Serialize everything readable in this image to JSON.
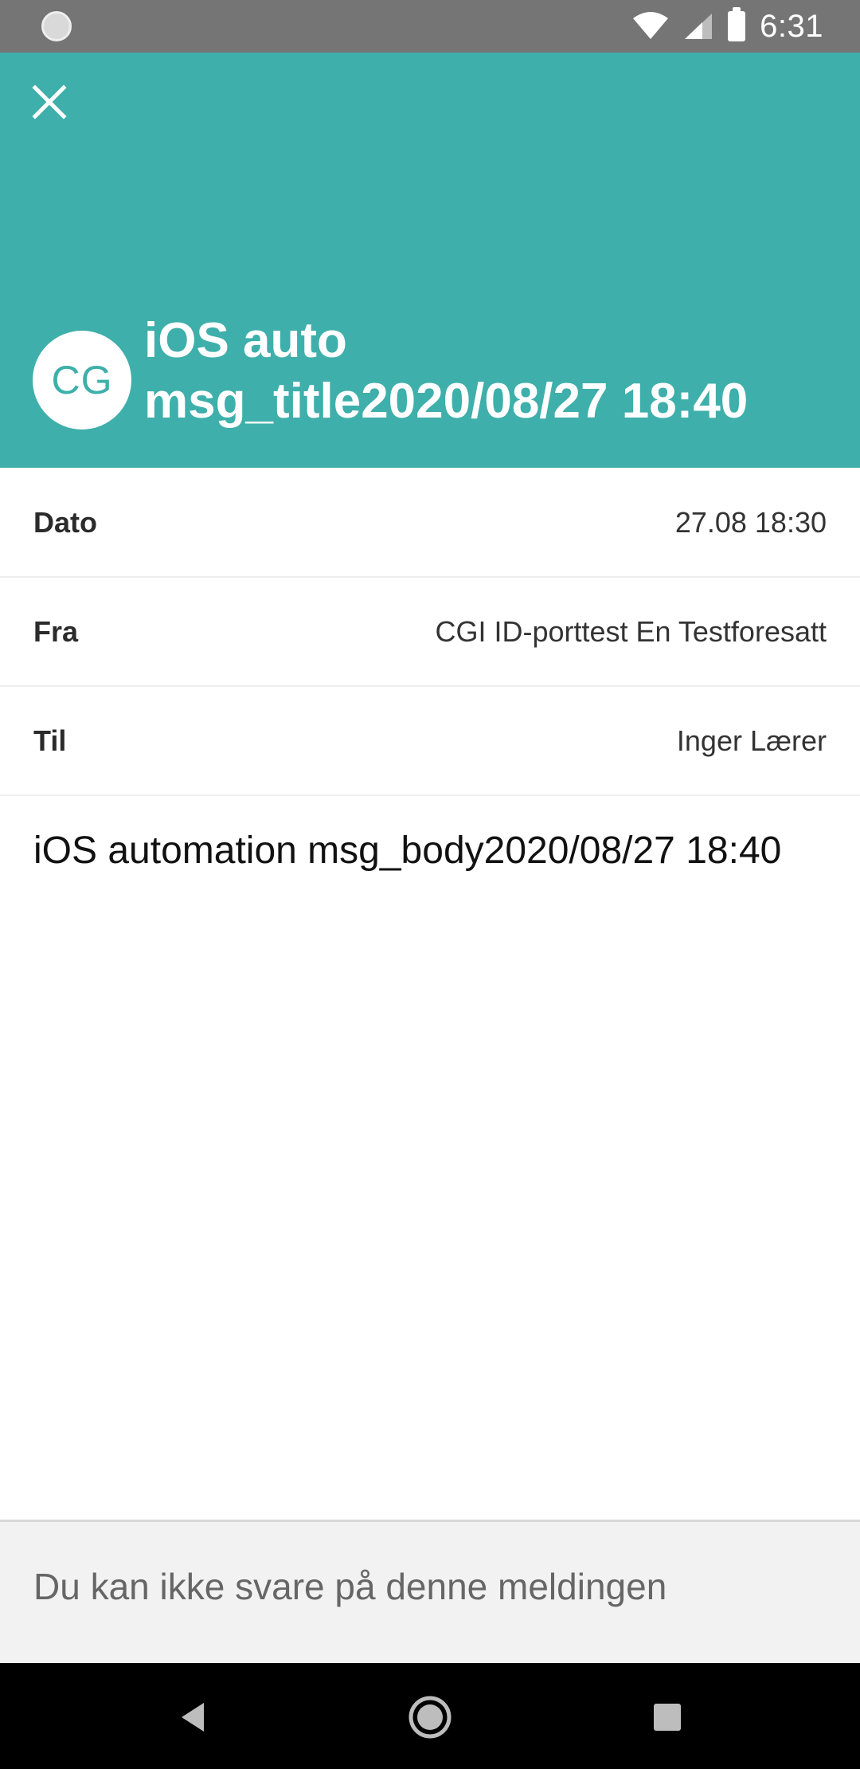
{
  "status_bar": {
    "time": "6:31",
    "icons": [
      "sync-icon",
      "wifi-icon",
      "cell-signal-icon",
      "battery-icon"
    ]
  },
  "header": {
    "close_icon": "close-icon",
    "avatar_initials": "CG",
    "title_line1": "iOS auto",
    "title_line2": "msg_title2020/08/27 18:40",
    "background_color": "#3eafab"
  },
  "meta": {
    "rows": [
      {
        "label": "Dato",
        "value": "27.08 18:30"
      },
      {
        "label": "Fra",
        "value": "CGI ID-porttest En Testforesatt"
      },
      {
        "label": "Til",
        "value": "Inger Lærer"
      }
    ]
  },
  "message": {
    "body": "iOS automation msg_body2020/08/27 18:40"
  },
  "reply": {
    "notice": "Du kan ikke svare på denne meldingen"
  },
  "nav_bar": {
    "icons": [
      "back-icon",
      "home-icon",
      "recents-icon"
    ]
  }
}
